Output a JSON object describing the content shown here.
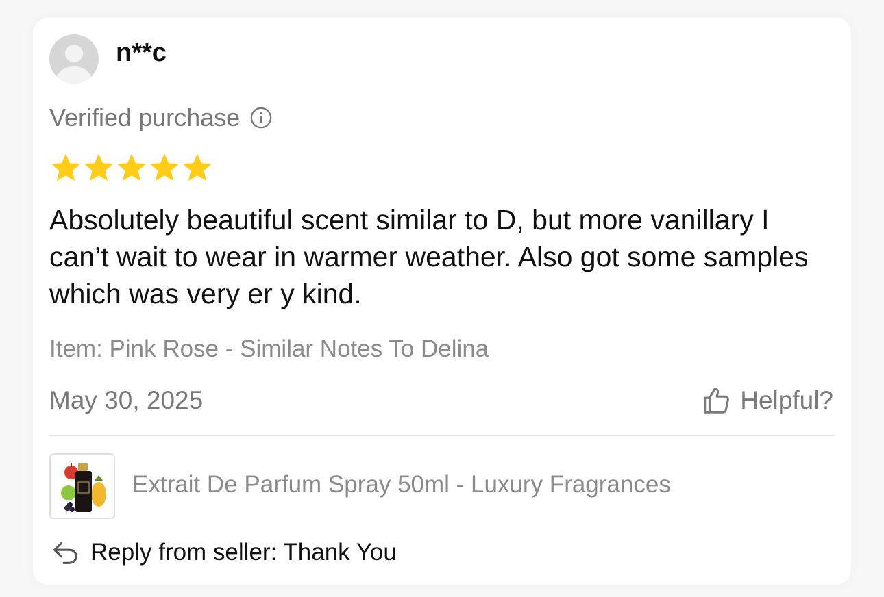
{
  "review": {
    "username": "n**c",
    "verified_label": "Verified purchase",
    "rating": 5,
    "rating_max": 5,
    "star_color": "#FFCC1A",
    "text": "Absolutely beautiful scent similar to D, but more vanillary I can’t wait to wear in warmer weather. Also got some samples which was very  er y kind.",
    "item_label": "Item: Pink Rose - Similar Notes To Delina",
    "date": "May 30, 2025",
    "helpful_label": "Helpful?",
    "product_name": "Extrait De Parfum Spray 50ml - Luxury Fragrances",
    "reply_text": "Reply from seller: Thank You"
  },
  "icons": {
    "info": "info-circle-icon",
    "helpful": "thumbs-up-icon",
    "reply": "reply-arrow-icon",
    "avatar": "default-avatar-icon"
  }
}
